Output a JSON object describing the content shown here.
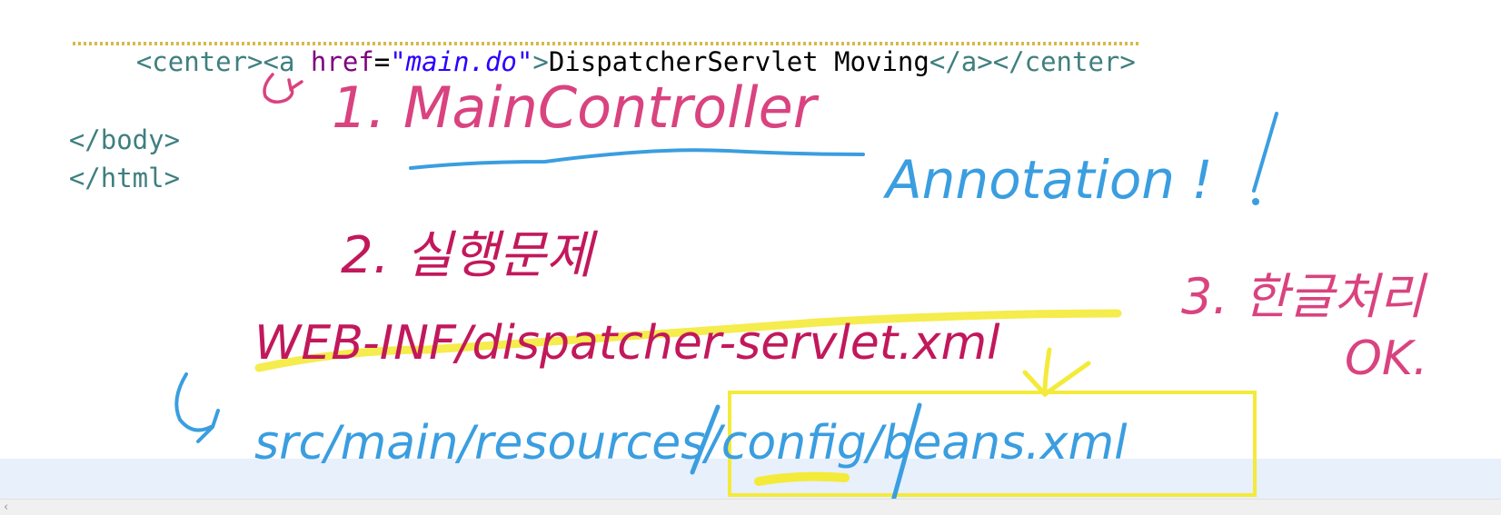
{
  "editor": {
    "code_lines": [
      {
        "parts": [
          {
            "t": "<center><a ",
            "c": "tag"
          },
          {
            "t": "href",
            "c": "attr"
          },
          {
            "t": "=",
            "c": "txt"
          },
          {
            "t": "\"main.do\"",
            "c": "str"
          },
          {
            "t": ">",
            "c": "tag"
          },
          {
            "t": "DispatcherServlet Moving",
            "c": "txt"
          },
          {
            "t": "</a></center>",
            "c": "tag"
          }
        ]
      },
      {
        "parts": [
          {
            "t": "</body>",
            "c": "tag"
          }
        ]
      },
      {
        "parts": [
          {
            "t": "</html>",
            "c": "tag"
          }
        ]
      }
    ]
  },
  "annotations": {
    "note1": "1. MainController",
    "note_annotation": "Annotation !",
    "note2": "2. 실행문제",
    "path_webinf": "WEB-INF/dispatcher-servlet.xml",
    "path_src": "src/main/resources/config/beans.xml",
    "note3": "3. 한글처리",
    "note_ok": "OK."
  },
  "colors": {
    "pink_ink": "#d9437f",
    "magenta_ink": "#c2185b",
    "blue_ink": "#3a9ee0",
    "yellow_highlight": "#f4ea3a",
    "tag": "#3f7f7f",
    "attr": "#7f007f",
    "string": "#2a00ff"
  }
}
